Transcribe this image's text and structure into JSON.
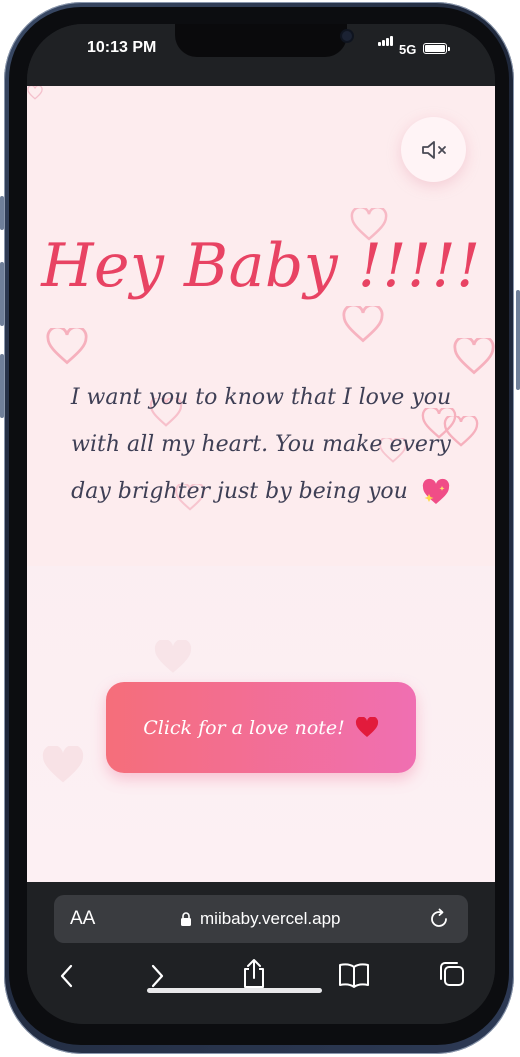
{
  "status_bar": {
    "time": "10:13 PM",
    "network": "5G"
  },
  "web_page": {
    "hero_title": "Hey Baby !!!!!",
    "hero_message": "I want you to know that I love you with all my heart. You make every day brighter just by being you",
    "mute_icon": "speaker-muted-icon",
    "cta_label": "Click for a love note!",
    "accent_color": "#e84363",
    "button_gradient": [
      "#f56e7a",
      "#f06fb2"
    ]
  },
  "browser": {
    "text_size_label": "AA",
    "url": "miibaby.vercel.app",
    "nav_icons": [
      "back-icon",
      "forward-icon",
      "share-icon",
      "bookmarks-icon",
      "tabs-icon"
    ]
  }
}
